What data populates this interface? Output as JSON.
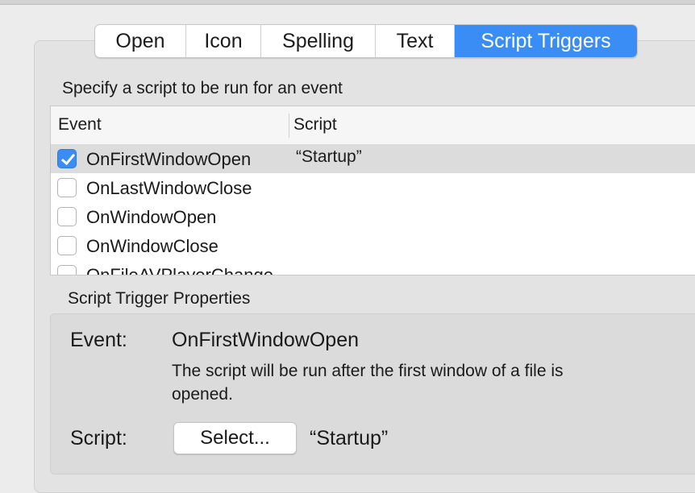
{
  "tabs": [
    {
      "label": "Open"
    },
    {
      "label": "Icon"
    },
    {
      "label": "Spelling"
    },
    {
      "label": "Text"
    },
    {
      "label": "Script Triggers",
      "active": true
    }
  ],
  "instruction": "Specify a script to be run for an event",
  "table": {
    "headers": {
      "event": "Event",
      "script": "Script"
    },
    "rows": [
      {
        "event": "OnFirstWindowOpen",
        "script": "“Startup”",
        "checked": true,
        "selected": true
      },
      {
        "event": "OnLastWindowClose",
        "script": "",
        "checked": false
      },
      {
        "event": "OnWindowOpen",
        "script": "",
        "checked": false
      },
      {
        "event": "OnWindowClose",
        "script": "",
        "checked": false
      },
      {
        "event": "OnFileAVPlayerChange",
        "script": "",
        "checked": false
      }
    ]
  },
  "properties": {
    "section_label": "Script Trigger Properties",
    "event_label": "Event:",
    "event_value": "OnFirstWindowOpen",
    "description": "The script will be run after the first window of a file is opened.",
    "script_label": "Script:",
    "select_button": "Select...",
    "script_value": "“Startup”"
  },
  "colors": {
    "accent": "#3a8df5",
    "selected_row": "#dcdcdc"
  }
}
